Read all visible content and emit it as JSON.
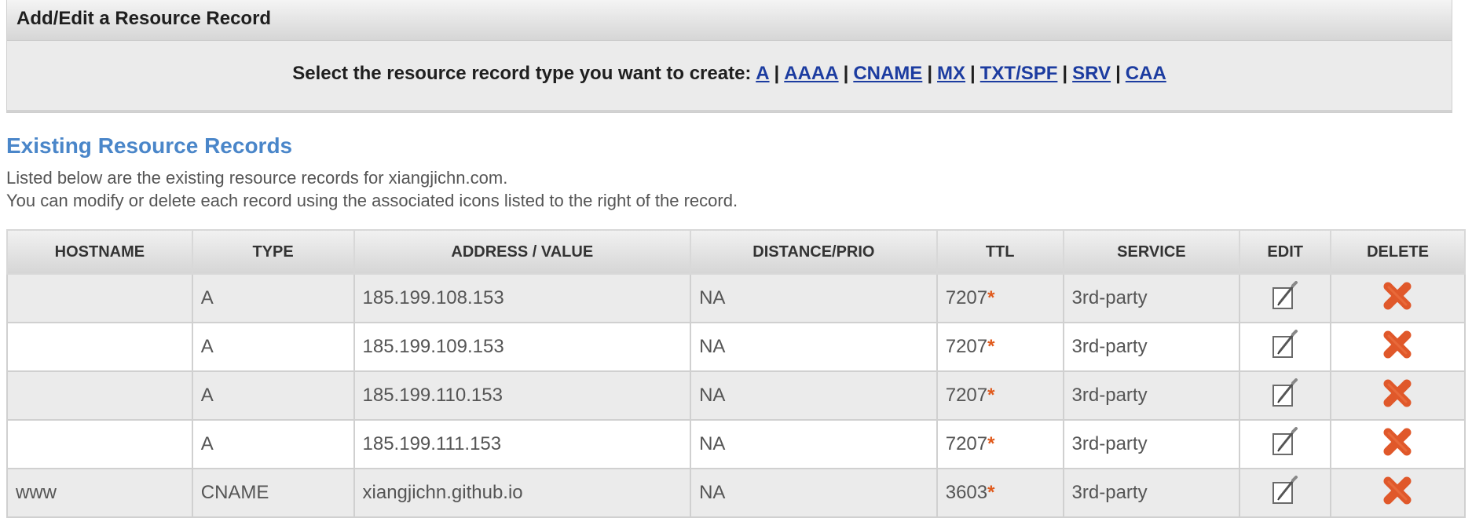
{
  "panel": {
    "title": "Add/Edit a Resource Record",
    "select_prompt": "Select the resource record type you want to create:",
    "record_types": [
      "A",
      "AAAA",
      "CNAME",
      "MX",
      "TXT/SPF",
      "SRV",
      "CAA"
    ]
  },
  "section": {
    "title": "Existing Resource Records",
    "line1": "Listed below are the existing resource records for xiangjichn.com.",
    "line2": "You can modify or delete each record using the associated icons listed to the right of the record."
  },
  "table": {
    "headers": [
      "HOSTNAME",
      "TYPE",
      "ADDRESS / VALUE",
      "DISTANCE/PRIO",
      "TTL",
      "SERVICE",
      "EDIT",
      "DELETE"
    ],
    "rows": [
      {
        "hostname": "",
        "type": "A",
        "value": "185.199.108.153",
        "prio": "NA",
        "ttl": "7207",
        "ttl_mark": "*",
        "service": "3rd-party"
      },
      {
        "hostname": "",
        "type": "A",
        "value": "185.199.109.153",
        "prio": "NA",
        "ttl": "7207",
        "ttl_mark": "*",
        "service": "3rd-party"
      },
      {
        "hostname": "",
        "type": "A",
        "value": "185.199.110.153",
        "prio": "NA",
        "ttl": "7207",
        "ttl_mark": "*",
        "service": "3rd-party"
      },
      {
        "hostname": "",
        "type": "A",
        "value": "185.199.111.153",
        "prio": "NA",
        "ttl": "7207",
        "ttl_mark": "*",
        "service": "3rd-party"
      },
      {
        "hostname": "www",
        "type": "CNAME",
        "value": "xiangjichn.github.io",
        "prio": "NA",
        "ttl": "3603",
        "ttl_mark": "*",
        "service": "3rd-party"
      }
    ]
  },
  "icons": {
    "edit": "edit-pencil-icon",
    "delete": "delete-x-icon"
  },
  "colors": {
    "link": "#1c3ca0",
    "section_title": "#4a86c9",
    "ttl_mark": "#e05a1c",
    "delete_icon": "#e0582a"
  }
}
